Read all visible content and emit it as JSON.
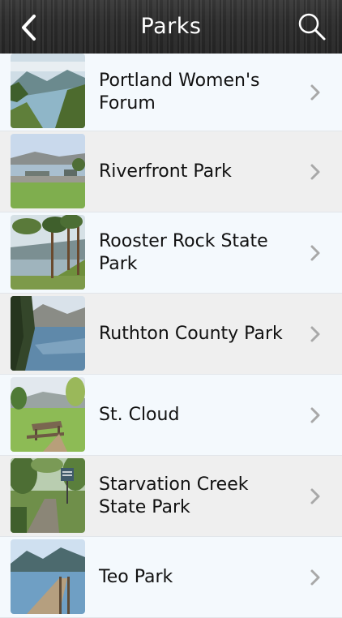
{
  "header": {
    "title": "Parks",
    "back_icon": "chevron-left-icon",
    "search_icon": "search-icon"
  },
  "parks": [
    {
      "name": "Portland Women's Forum",
      "image": "river-gorge-overlook-photo"
    },
    {
      "name": "Riverfront Park",
      "image": "riverside-lawn-photo"
    },
    {
      "name": "Rooster Rock State Park",
      "image": "pine-trees-riverbank-photo"
    },
    {
      "name": "Ruthton County Park",
      "image": "river-cliffs-photo"
    },
    {
      "name": "St. Cloud",
      "image": "picnic-table-meadow-photo"
    },
    {
      "name": "Starvation Creek State Park",
      "image": "forest-trail-sign-photo"
    },
    {
      "name": "Teo Park",
      "image": "pier-mountain-photo"
    }
  ],
  "colors": {
    "row_light": "#f4f9fd",
    "row_dark": "#efefef",
    "chevron": "#a8a8a8",
    "navbar": "#2e2e2e"
  }
}
